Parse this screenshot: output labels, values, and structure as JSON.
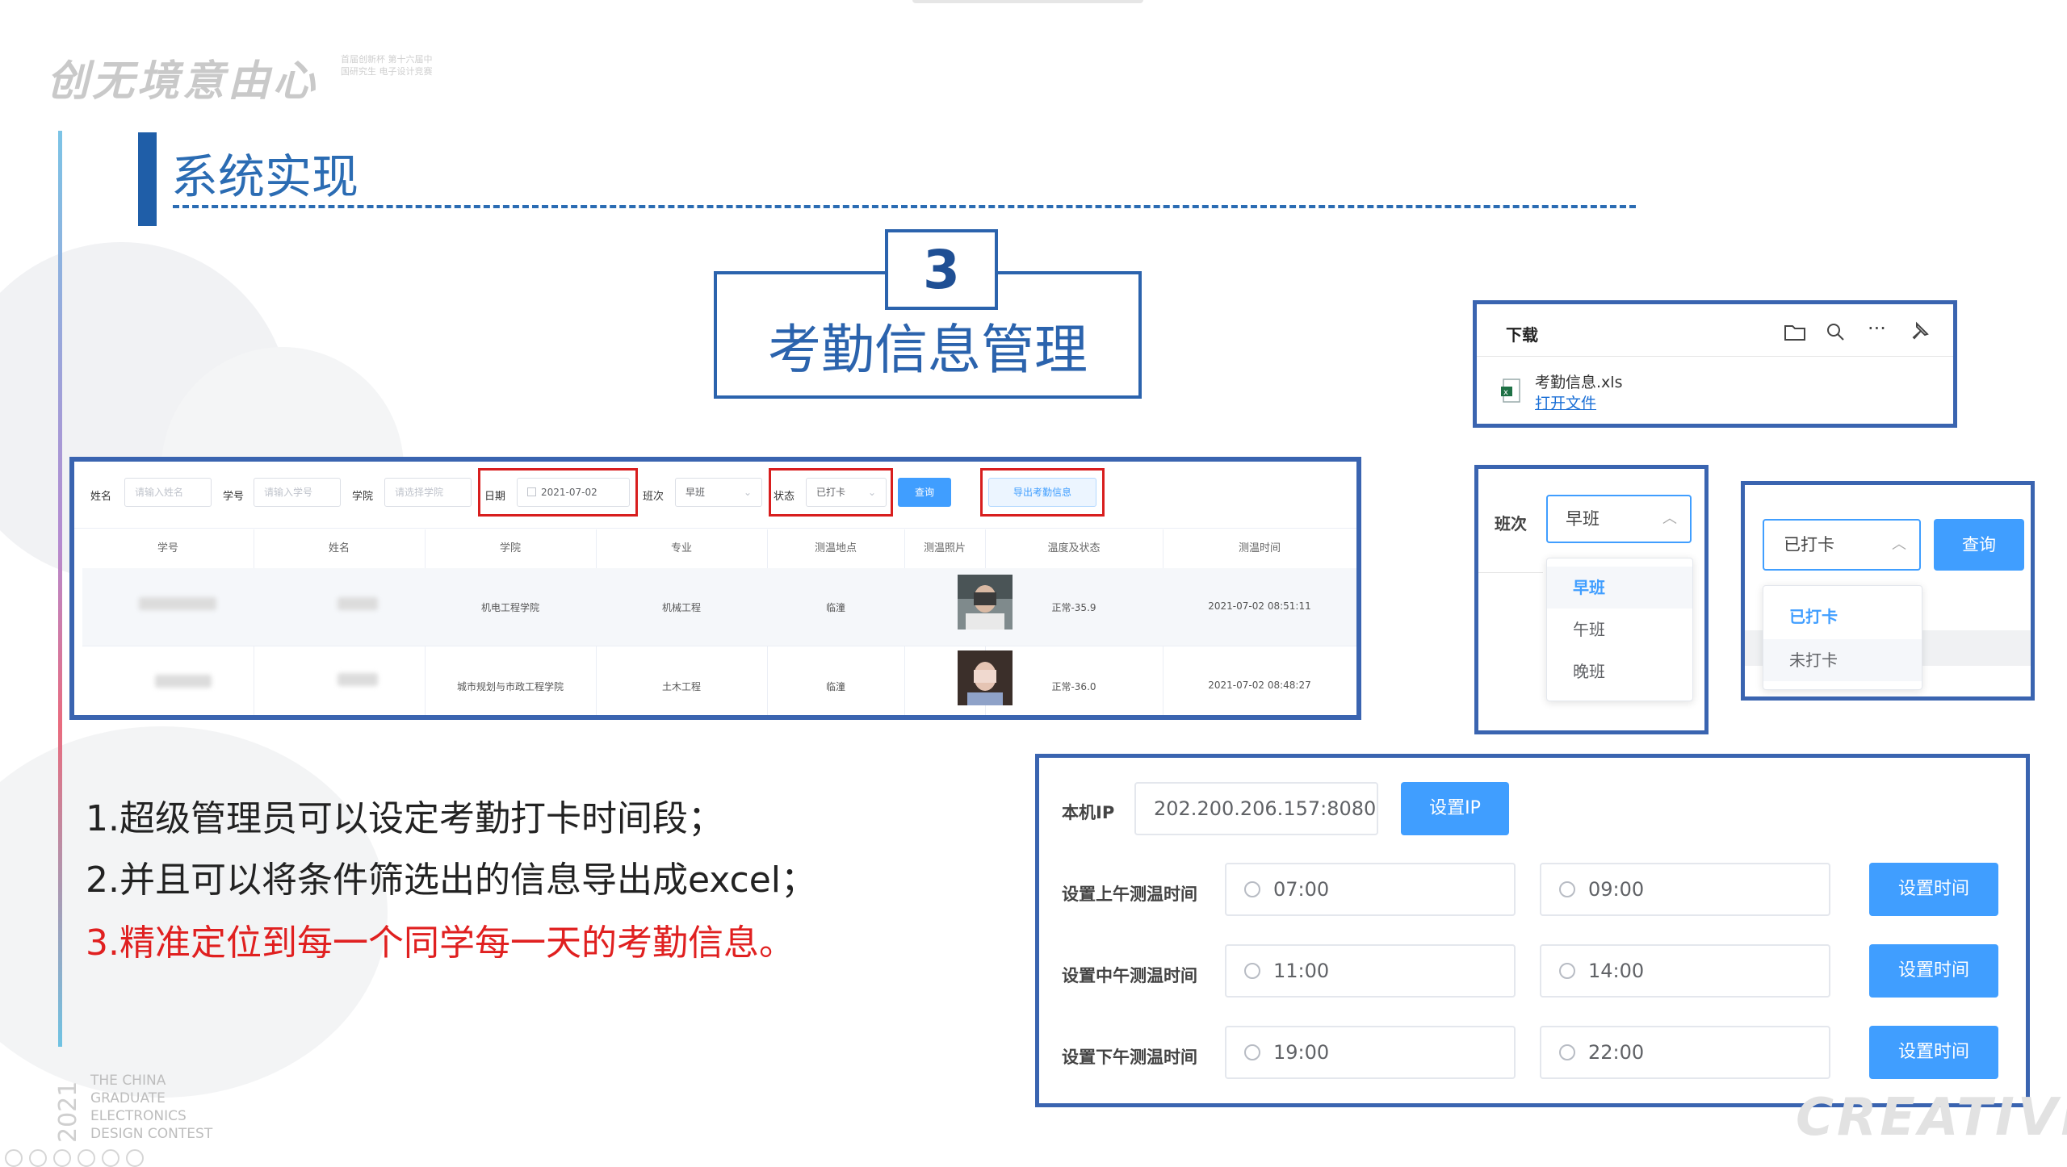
{
  "header": {
    "logo_text": "创无境意由心",
    "logo_subtext": "首届创新杯 第十六届中国研究生 电子设计竞赛",
    "section_title": "系统实现"
  },
  "title_box": {
    "number": "3",
    "title": "考勤信息管理"
  },
  "attendance_table": {
    "filters": {
      "name_label": "姓名",
      "name_placeholder": "请输入姓名",
      "id_label": "学号",
      "id_placeholder": "请输入学号",
      "college_label": "学院",
      "college_placeholder": "请选择学院",
      "date_label": "日期",
      "date_value": "2021-07-02",
      "shift_label": "班次",
      "shift_value": "早班",
      "status_label": "状态",
      "status_value": "已打卡",
      "query_button": "查询",
      "export_button": "导出考勤信息"
    },
    "columns": [
      "学号",
      "姓名",
      "学院",
      "专业",
      "测温地点",
      "测温照片",
      "温度及状态",
      "测温时间"
    ],
    "rows": [
      {
        "college": "机电工程学院",
        "major": "机械工程",
        "location": "临潼",
        "temp_status": "正常-35.9",
        "time": "2021-07-02 08:51:11"
      },
      {
        "college": "城市规划与市政工程学院",
        "major": "土木工程",
        "location": "临潼",
        "temp_status": "正常-36.0",
        "time": "2021-07-02 08:48:27"
      }
    ]
  },
  "download_panel": {
    "title": "下载",
    "file_name": "考勤信息.xls",
    "open_link": "打开文件"
  },
  "shift_dropdown": {
    "label": "班次",
    "selected": "早班",
    "options": [
      "早班",
      "午班",
      "晚班"
    ]
  },
  "status_dropdown": {
    "selected": "已打卡",
    "query_button": "查询",
    "options": [
      "已打卡",
      "未打卡"
    ]
  },
  "points": [
    "1.超级管理员可以设定考勤打卡时间段；",
    "2.并且可以将条件筛选出的信息导出成excel；",
    "3.精准定位到每一个同学每一天的考勤信息。"
  ],
  "settings": {
    "ip_label": "本机IP",
    "ip_value": "202.200.206.157:8080",
    "ip_button": "设置IP",
    "rows": [
      {
        "label": "设置上午测温时间",
        "start": "07:00",
        "end": "09:00",
        "button": "设置时间"
      },
      {
        "label": "设置中午测温时间",
        "start": "11:00",
        "end": "14:00",
        "button": "设置时间"
      },
      {
        "label": "设置下午测温时间",
        "start": "19:00",
        "end": "22:00",
        "button": "设置时间"
      }
    ]
  },
  "footer": {
    "year": "2021",
    "contest_lines": [
      "THE CHINA",
      "GRADUATE",
      "ELECTRONICS",
      "DESIGN CONTEST"
    ],
    "creative": "CREATIVE"
  },
  "colors": {
    "frame_blue": "#3a64b0",
    "title_blue": "#2b63ad",
    "button_blue": "#409eff",
    "highlight_red": "#d81e1e",
    "point_red": "#e02020"
  }
}
